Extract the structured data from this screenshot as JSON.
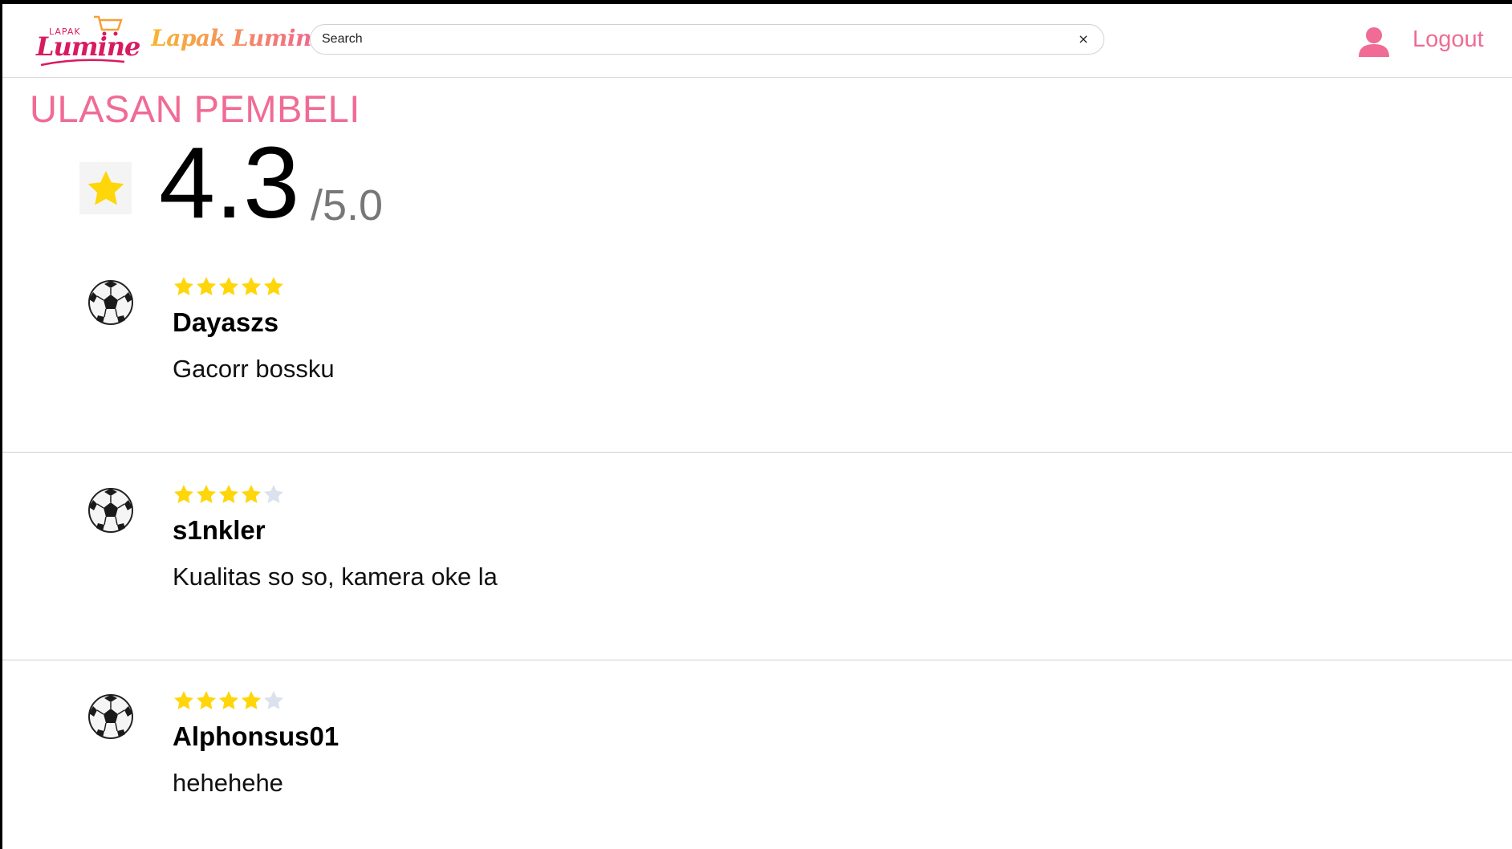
{
  "header": {
    "logo_small": "LAPAK",
    "logo_main": "Lumine",
    "brand_name": "Lapak Lumine",
    "search": {
      "placeholder": "Search",
      "value": ""
    },
    "clear_label": "×",
    "logout_label": "Logout"
  },
  "colors": {
    "accent_pink": "#f06b95",
    "star_filled": "#ffd60a",
    "star_empty": "#dbe2ee"
  },
  "rating_summary": {
    "title": "ULASAN PEMBELI",
    "average": "4.3",
    "max": "/5.0"
  },
  "reviews": [
    {
      "stars": 5,
      "name": "Dayaszs",
      "comment": "Gacorr bossku",
      "avatar_icon": "soccer-ball-icon"
    },
    {
      "stars": 4,
      "name": "s1nkler",
      "comment": "Kualitas so so, kamera oke la",
      "avatar_icon": "soccer-ball-icon"
    },
    {
      "stars": 4,
      "name": "Alphonsus01",
      "comment": "hehehehe",
      "avatar_icon": "soccer-ball-icon"
    }
  ]
}
